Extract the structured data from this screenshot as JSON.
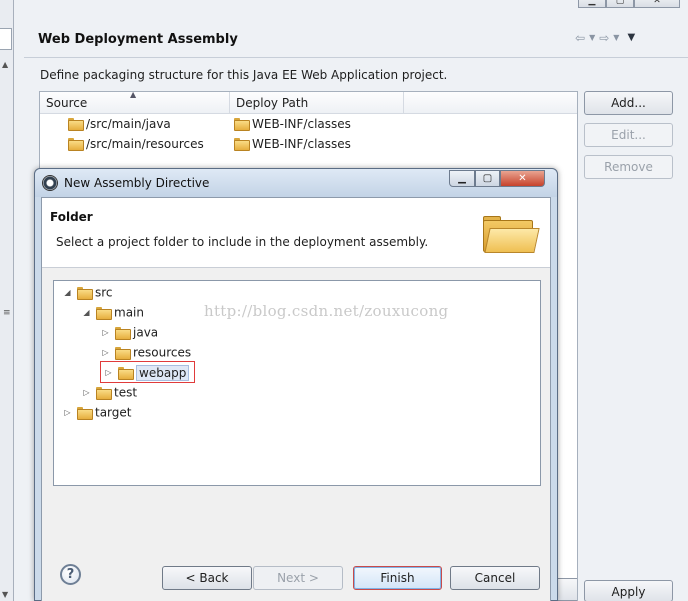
{
  "background": {
    "page_title": "Web Deployment Assembly",
    "description": "Define packaging structure for this Java EE Web Application project.",
    "table": {
      "columns": [
        "Source",
        "Deploy Path"
      ],
      "rows": [
        {
          "source": "/src/main/java",
          "deploy_path": "WEB-INF/classes"
        },
        {
          "source": "/src/main/resources",
          "deploy_path": "WEB-INF/classes"
        }
      ]
    },
    "buttons": {
      "add": "Add...",
      "edit": "Edit...",
      "remove": "Remove",
      "apply": "Apply"
    }
  },
  "dialog": {
    "title": "New Assembly Directive",
    "header_title": "Folder",
    "header_desc": "Select a project folder to include in the deployment assembly.",
    "tree": [
      {
        "label": "src",
        "expanded": true
      },
      {
        "label": "main",
        "expanded": true
      },
      {
        "label": "java",
        "expanded": false
      },
      {
        "label": "resources",
        "expanded": false
      },
      {
        "label": "webapp",
        "expanded": false,
        "selected": true
      },
      {
        "label": "test",
        "expanded": false
      },
      {
        "label": "target",
        "expanded": false
      }
    ],
    "buttons": {
      "back": "< Back",
      "next": "Next >",
      "finish": "Finish",
      "cancel": "Cancel"
    },
    "help_symbol": "?"
  },
  "watermark": "http://blog.csdn.net/zouxucong"
}
